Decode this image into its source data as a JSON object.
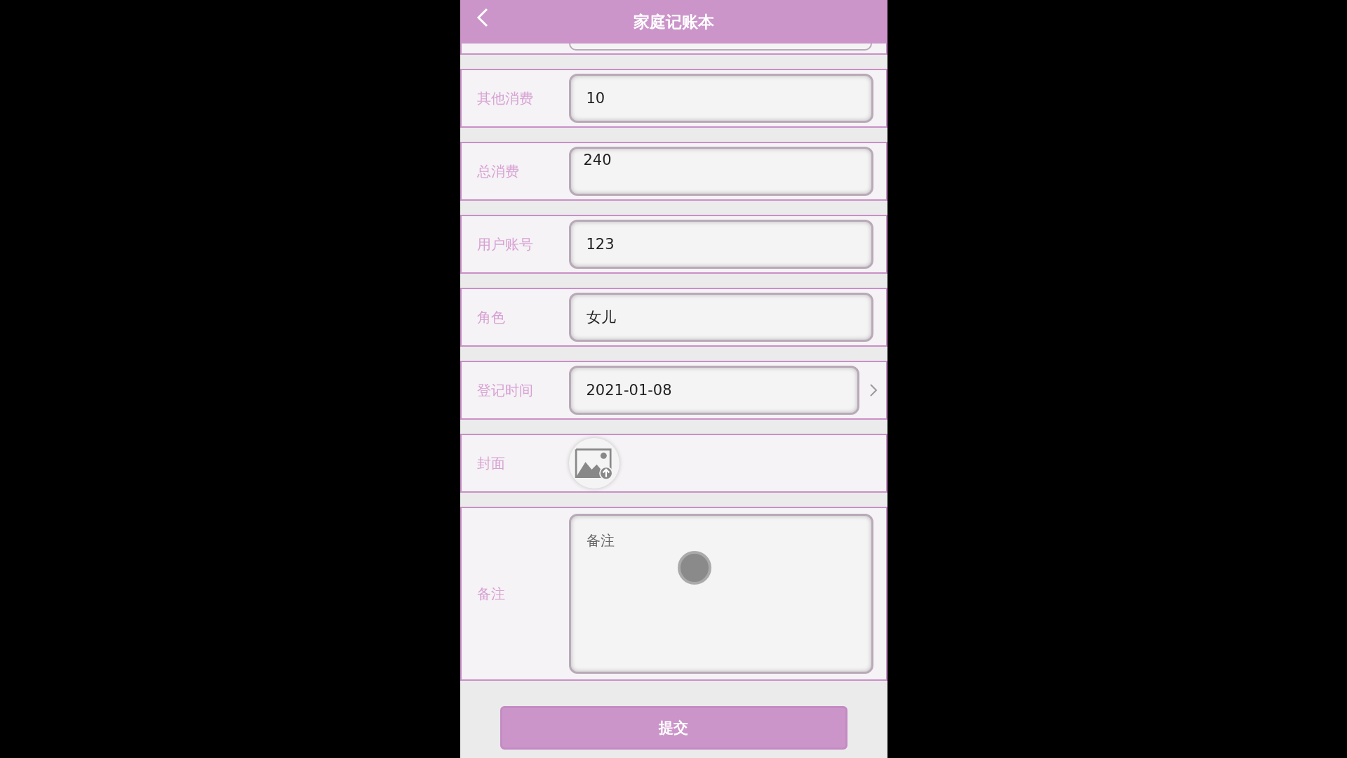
{
  "header": {
    "title": "家庭记账本"
  },
  "fields": [
    {
      "kind": "input",
      "label": "其他消费",
      "value": "10"
    },
    {
      "kind": "multiline",
      "label": "总消费",
      "value": "240"
    },
    {
      "kind": "input",
      "label": "用户账号",
      "value": "123"
    },
    {
      "kind": "input",
      "label": "角色",
      "value": "女儿"
    },
    {
      "kind": "date",
      "label": "登记时间",
      "value": "2021-01-08"
    },
    {
      "kind": "upload",
      "label": "封面"
    },
    {
      "kind": "textarea",
      "label": "备注",
      "placeholder": "备注"
    }
  ],
  "submit": {
    "label": "提交"
  }
}
